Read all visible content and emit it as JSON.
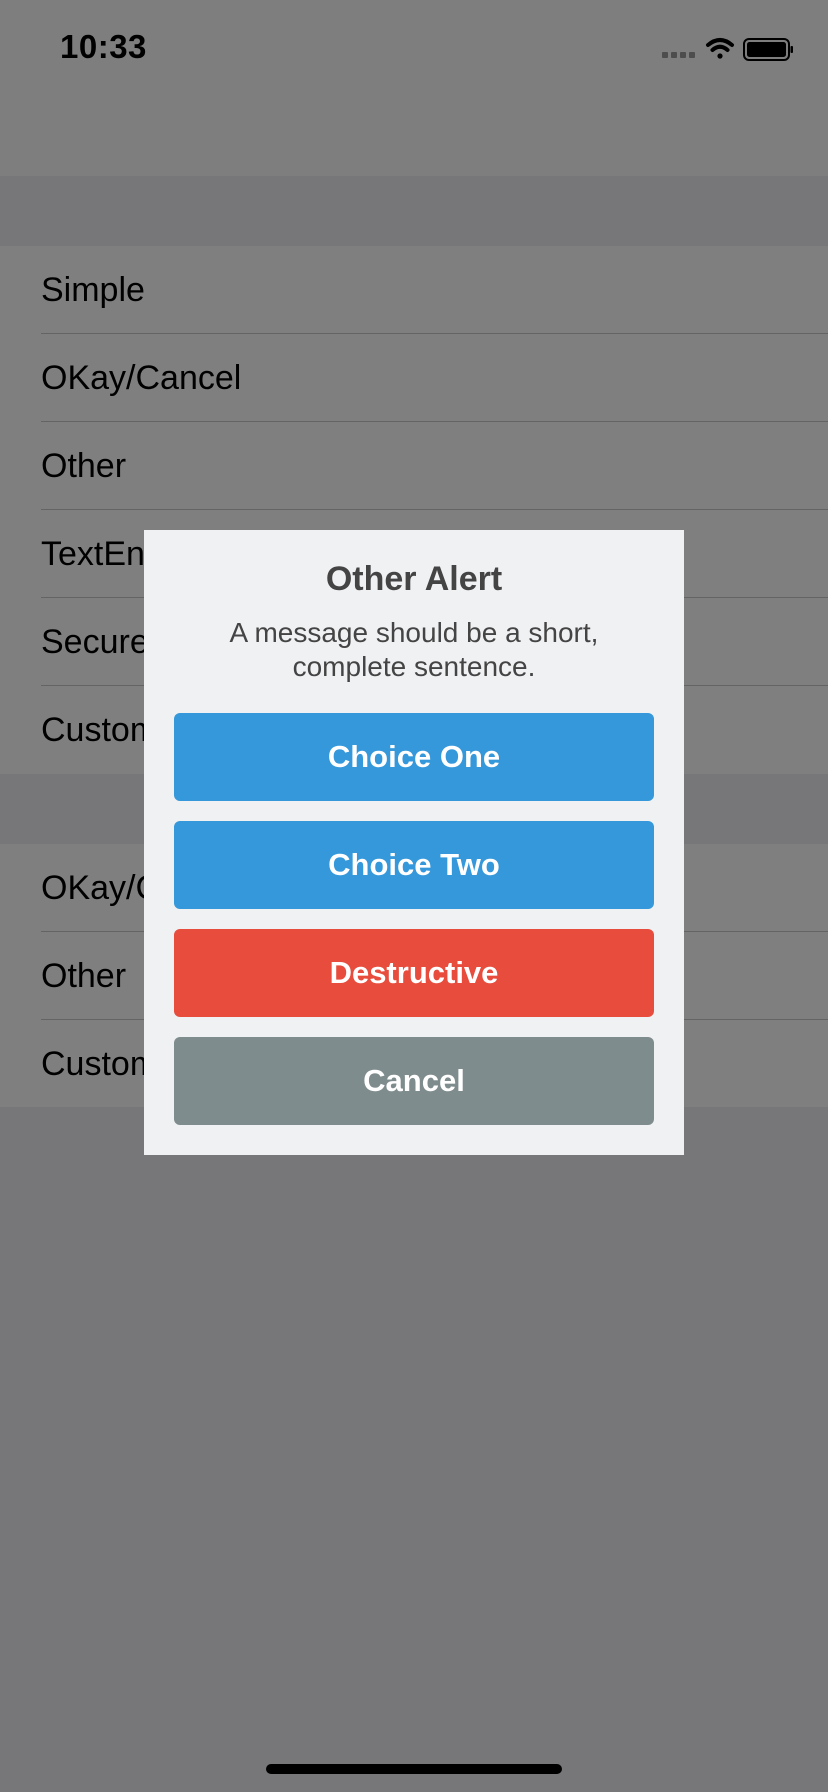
{
  "status_bar": {
    "time": "10:33"
  },
  "table": {
    "sections": [
      {
        "rows": [
          {
            "label": "Simple"
          },
          {
            "label": "OKay/Cancel"
          },
          {
            "label": "Other"
          },
          {
            "label": "TextEntry"
          },
          {
            "label": "SecureTextEntry"
          },
          {
            "label": "Custom"
          }
        ]
      },
      {
        "rows": [
          {
            "label": "OKay/Cancel"
          },
          {
            "label": "Other"
          },
          {
            "label": "Custom"
          }
        ]
      }
    ]
  },
  "alert": {
    "title": "Other Alert",
    "message": "A message should be a short, complete sentence.",
    "buttons": [
      {
        "label": "Choice One",
        "color": "#3498db"
      },
      {
        "label": "Choice Two",
        "color": "#3498db"
      },
      {
        "label": "Destructive",
        "color": "#e74c3c"
      },
      {
        "label": "Cancel",
        "color": "#7f8c8d"
      }
    ]
  },
  "icons": {
    "signal": "cellular-signal-icon",
    "wifi": "wifi-icon",
    "battery": "battery-icon"
  }
}
